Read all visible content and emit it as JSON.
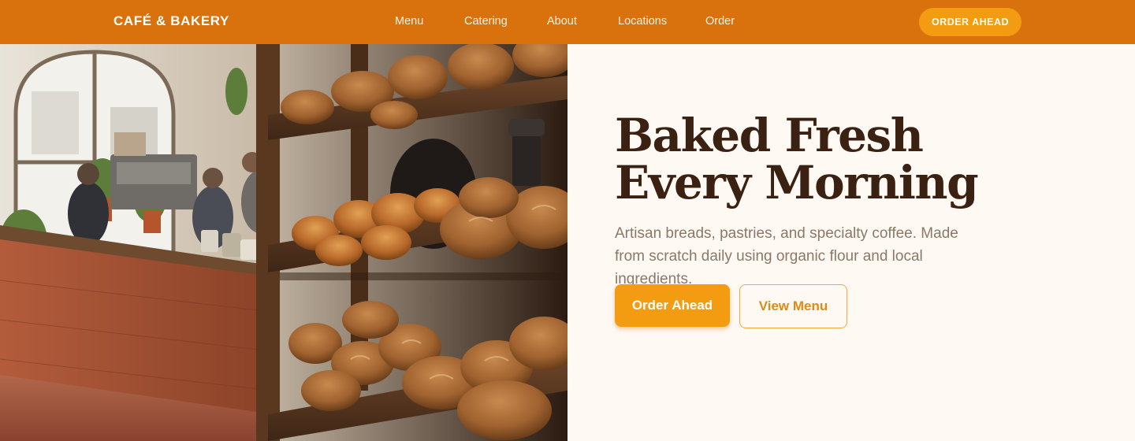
{
  "nav": {
    "brand": "CAFÉ & BAKERY",
    "links": [
      "Menu",
      "Catering",
      "About",
      "Locations",
      "Order"
    ],
    "cta": "ORDER AHEAD"
  },
  "hero": {
    "title": "Baked Fresh Every Morning",
    "subtitle": "Artisan breads, pastries, and specialty coffee. Made from scratch daily using organic flour and local ingredients.",
    "primary_button": "Order Ahead",
    "secondary_button": "View Menu"
  },
  "colors": {
    "nav_bg": "#d9720c",
    "accent": "#f39c12",
    "page_bg": "#fff9f4",
    "title": "#3b2112",
    "body_text": "#8a7868"
  }
}
